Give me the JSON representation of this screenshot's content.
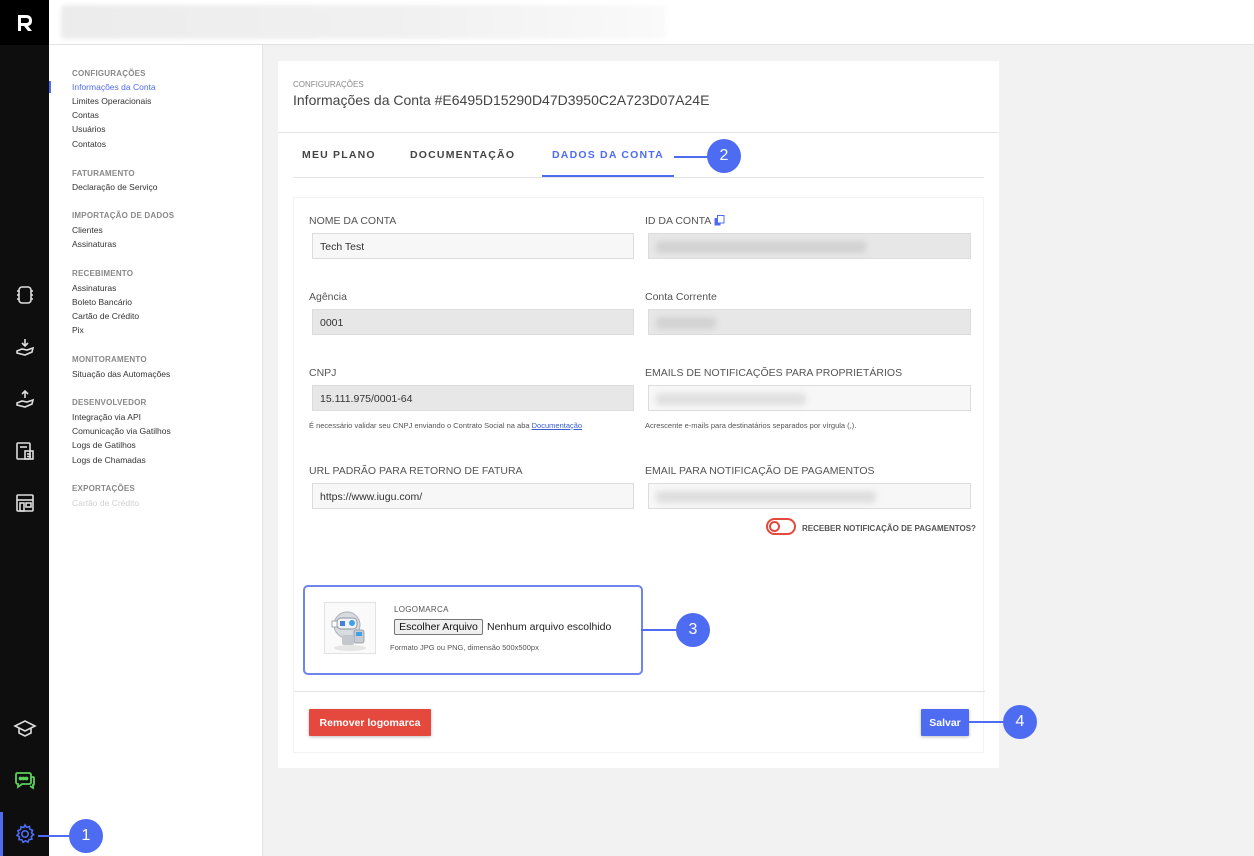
{
  "colors": {
    "accent": "#4e6cf2",
    "danger": "#e5483d",
    "rail": "#0e0e0e"
  },
  "rail": {
    "icons": [
      "logo-icon",
      "invoice-icon",
      "receive-money-icon",
      "send-money-icon",
      "calculator-icon",
      "store-icon",
      "academy-icon",
      "chat-icon",
      "settings-icon"
    ]
  },
  "sidebar": {
    "sections": [
      {
        "title": "CONFIGURAÇÕES",
        "items": [
          "Informações da Conta",
          "Limites Operacionais",
          "Contas",
          "Usuários",
          "Contatos"
        ]
      },
      {
        "title": "FATURAMENTO",
        "items": [
          "Declaração de Serviço"
        ]
      },
      {
        "title": "IMPORTAÇÃO DE DADOS",
        "items": [
          "Clientes",
          "Assinaturas"
        ]
      },
      {
        "title": "RECEBIMENTO",
        "items": [
          "Assinaturas",
          "Boleto Bancário",
          "Cartão de Crédito",
          "Pix"
        ]
      },
      {
        "title": "MONITORAMENTO",
        "items": [
          "Situação das Automações"
        ]
      },
      {
        "title": "DESENVOLVEDOR",
        "items": [
          "Integração via API",
          "Comunicação via Gatilhos",
          "Logs de Gatilhos",
          "Logs de Chamadas"
        ]
      },
      {
        "title": "EXPORTAÇÕES",
        "items": [
          "Cartão de Crédito"
        ]
      }
    ]
  },
  "page": {
    "breadcrumb": "CONFIGURAÇÕES",
    "title": "Informações da Conta #E6495D15290D47D3950C2A723D07A24E"
  },
  "tabs": [
    "MEU PLANO",
    "DOCUMENTAÇÃO",
    "DADOS DA CONTA"
  ],
  "form": {
    "account_name_label": "NOME DA CONTA",
    "account_name_value": "Tech Test",
    "account_id_label": "ID DA CONTA",
    "agency_label": "Agência",
    "agency_value": "0001",
    "checking_label": "Conta Corrente",
    "cnpj_label": "CNPJ",
    "cnpj_value": "15.111.975/0001-64",
    "cnpj_hint": "É necessário validar seu CNPJ enviando o Contrato Social na aba ",
    "cnpj_hint_link": "Documentação",
    "owner_emails_label": "EMAILS DE NOTIFICAÇÕES PARA PROPRIETÁRIOS",
    "owner_emails_hint": "Acrescente e-mails para destinatários separados por vírgula (,).",
    "return_url_label": "URL PADRÃO PARA RETORNO DE FATURA",
    "return_url_value": "https://www.iugu.com/",
    "payment_email_label": "EMAIL PARA NOTIFICAÇÃO DE PAGAMENTOS",
    "toggle_label": "RECEBER NOTIFICAÇÃO DE PAGAMENTOS?",
    "toggle_on": false
  },
  "logo": {
    "title": "LOGOMARCA",
    "choose_button": "Escolher Arquivo",
    "no_file": "Nenhum arquivo escolhido",
    "format_hint": "Formato JPG ou PNG, dimensão 500x500px"
  },
  "actions": {
    "remove_logo": "Remover logomarca",
    "save": "Salvar"
  },
  "callouts": [
    "1",
    "2",
    "3",
    "4"
  ]
}
